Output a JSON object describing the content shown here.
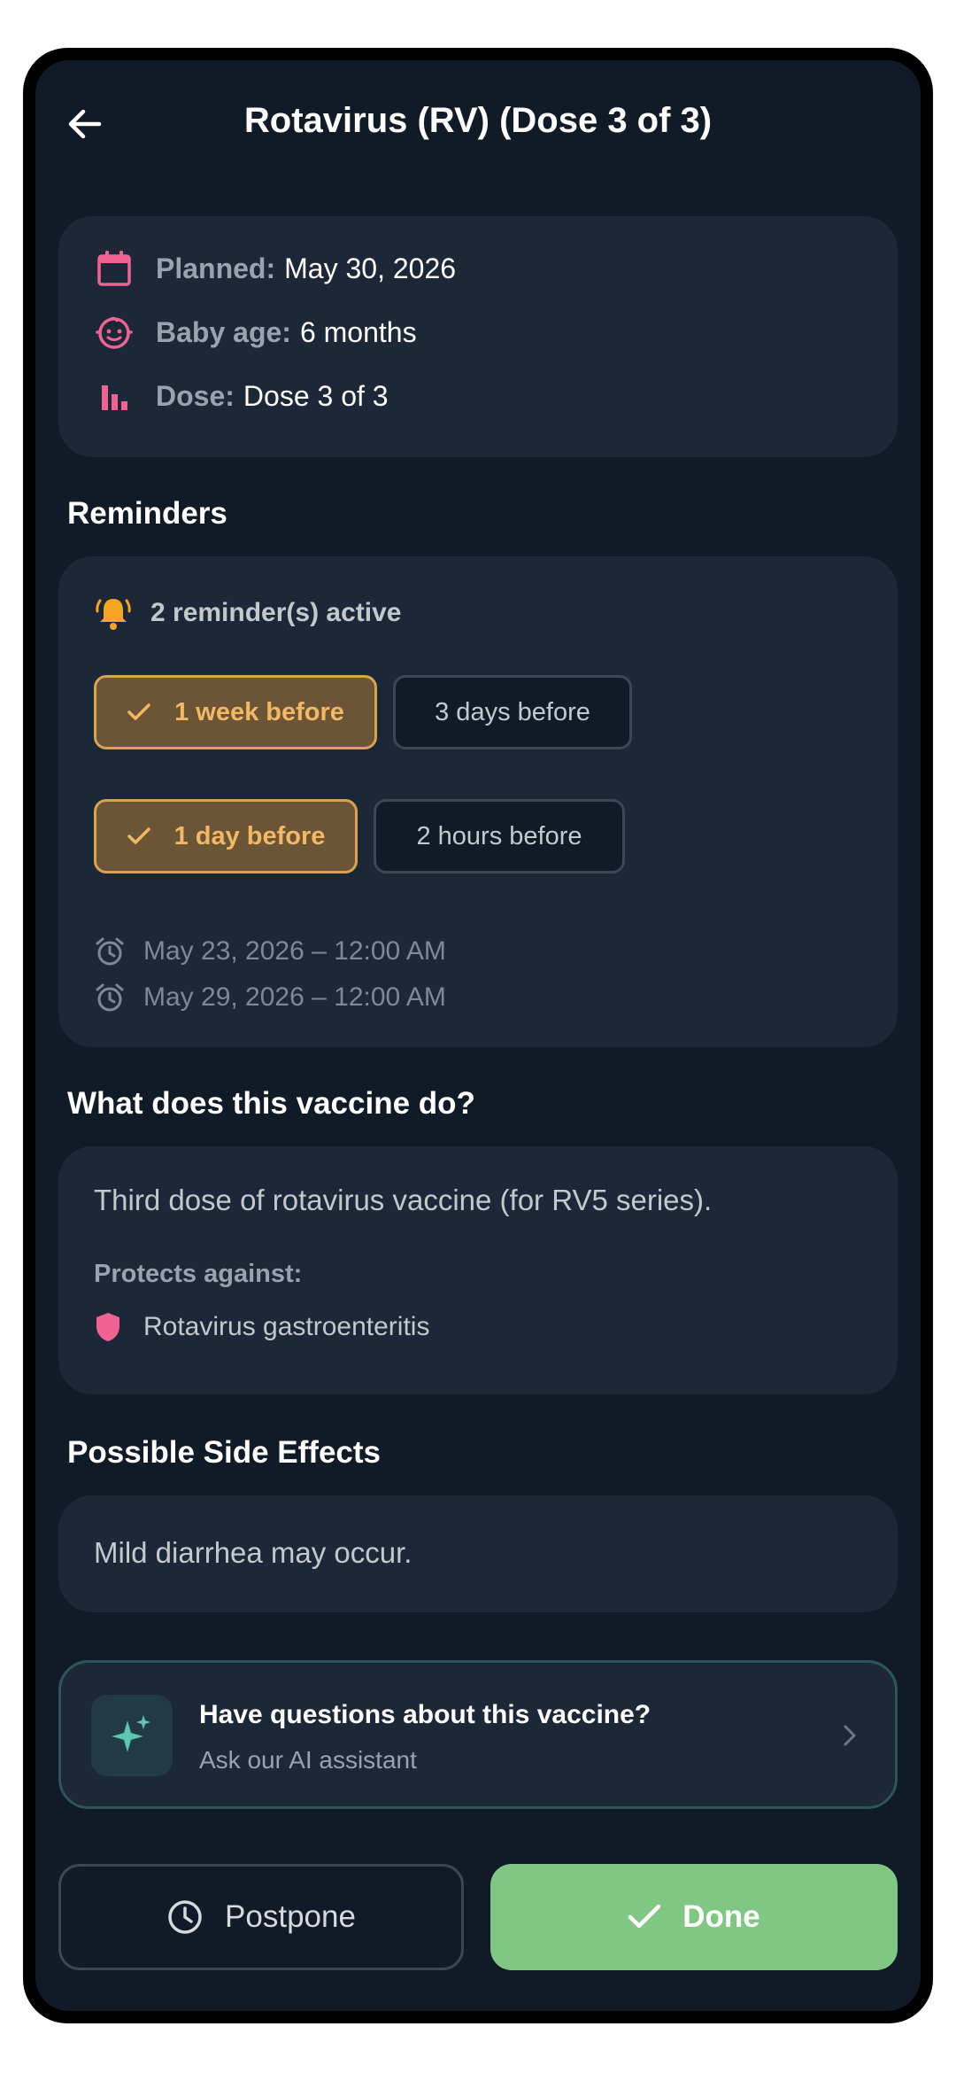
{
  "header": {
    "title": "Rotavirus (RV) (Dose 3 of 3)",
    "back_icon": "arrow-left-icon"
  },
  "info": {
    "planned": {
      "label": "Planned:",
      "value": "May 30, 2026",
      "icon": "calendar-icon"
    },
    "baby_age": {
      "label": "Baby age:",
      "value": "6 months",
      "icon": "baby-face-icon"
    },
    "dose": {
      "label": "Dose:",
      "value": "Dose 3 of 3",
      "icon": "bar-chart-icon"
    }
  },
  "reminders": {
    "section_title": "Reminders",
    "status": "2 reminder(s) active",
    "options": [
      {
        "label": "1 week before",
        "selected": true
      },
      {
        "label": "3 days before",
        "selected": false
      },
      {
        "label": "1 day before",
        "selected": true
      },
      {
        "label": "2 hours before",
        "selected": false
      }
    ],
    "scheduled": [
      "May 23, 2026 – 12:00 AM",
      "May 29, 2026 – 12:00 AM"
    ]
  },
  "vaccine_info": {
    "section_title": "What does this vaccine do?",
    "description": "Third dose of rotavirus vaccine (for RV5 series).",
    "protects_label": "Protects against:",
    "protects": [
      "Rotavirus gastroenteritis"
    ]
  },
  "side_effects": {
    "section_title": "Possible Side Effects",
    "text": "Mild diarrhea may occur."
  },
  "assistant": {
    "title": "Have questions about this vaccine?",
    "subtitle": "Ask our AI assistant"
  },
  "actions": {
    "postpone": "Postpone",
    "done": "Done"
  },
  "colors": {
    "background": "#111b28",
    "card": "#1c2838",
    "accent_pink": "#f06292",
    "accent_amber": "#f3b864",
    "done_green": "#80c783",
    "ai_teal": "#5ec4b0"
  }
}
